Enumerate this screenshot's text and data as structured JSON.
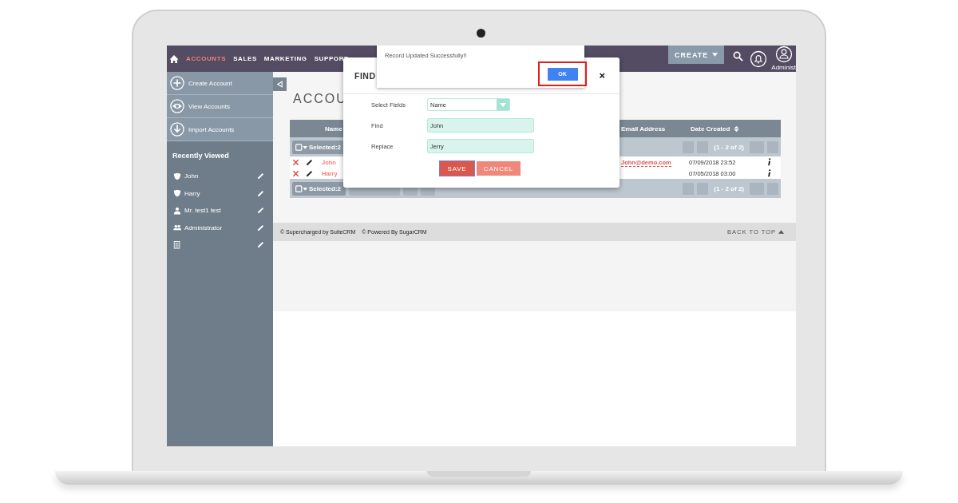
{
  "nav": {
    "items": [
      {
        "label": "ACCOUNTS",
        "selected": true
      },
      {
        "label": "SALES",
        "selected": false
      },
      {
        "label": "MARKETING",
        "selected": false
      },
      {
        "label": "SUPPORT",
        "selected": false
      }
    ],
    "create": "CREATE",
    "user": "Administ"
  },
  "sidebar": {
    "actions": [
      {
        "label": "Create Account",
        "kind": "create"
      },
      {
        "label": "View Accounts",
        "kind": "view"
      },
      {
        "label": "Import Accounts",
        "kind": "import"
      }
    ],
    "recent_title": "Recently Viewed",
    "recent": [
      {
        "label": "John",
        "kind": "account"
      },
      {
        "label": "Harry",
        "kind": "account"
      },
      {
        "label": "Mr. test1 test",
        "kind": "contact"
      },
      {
        "label": "Administrator",
        "kind": "user"
      },
      {
        "kind": "document"
      }
    ]
  },
  "page": {
    "title": "ACCOU"
  },
  "table": {
    "columns": [
      "Name",
      "Email Address",
      "Date Created"
    ],
    "top_bar": {
      "selection": "Selected:2",
      "pagination": "(1 - 2 of 2)"
    },
    "rows": [
      {
        "name": "John",
        "email": "John@demo.com",
        "date": "07/09/2018 23:52"
      },
      {
        "name": "Harry",
        "date": "07/05/2018 03:00"
      }
    ],
    "bottom_bar": {
      "selection": "Selected:2",
      "pagination": "(1 - 2 of 2)"
    }
  },
  "footer": {
    "credits": [
      "© Supercharged by SuiteCRM",
      "© Powered By SugarCRM"
    ],
    "back_to_top": "BACK TO TOP"
  },
  "dialog": {
    "title": "FIND",
    "close": "×",
    "fields": [
      {
        "label": "Select Fields",
        "kind": "select",
        "value": "Name"
      },
      {
        "label": "Find",
        "kind": "text",
        "value": "John"
      },
      {
        "label": "Replace",
        "kind": "text",
        "value": "Jerry"
      }
    ],
    "buttons": [
      {
        "label": "SAVE",
        "kind": "primary"
      },
      {
        "label": "CANCEL",
        "kind": "secondary"
      }
    ]
  },
  "toast": {
    "message": "Record Updated Successfully!!",
    "button": "OK"
  }
}
